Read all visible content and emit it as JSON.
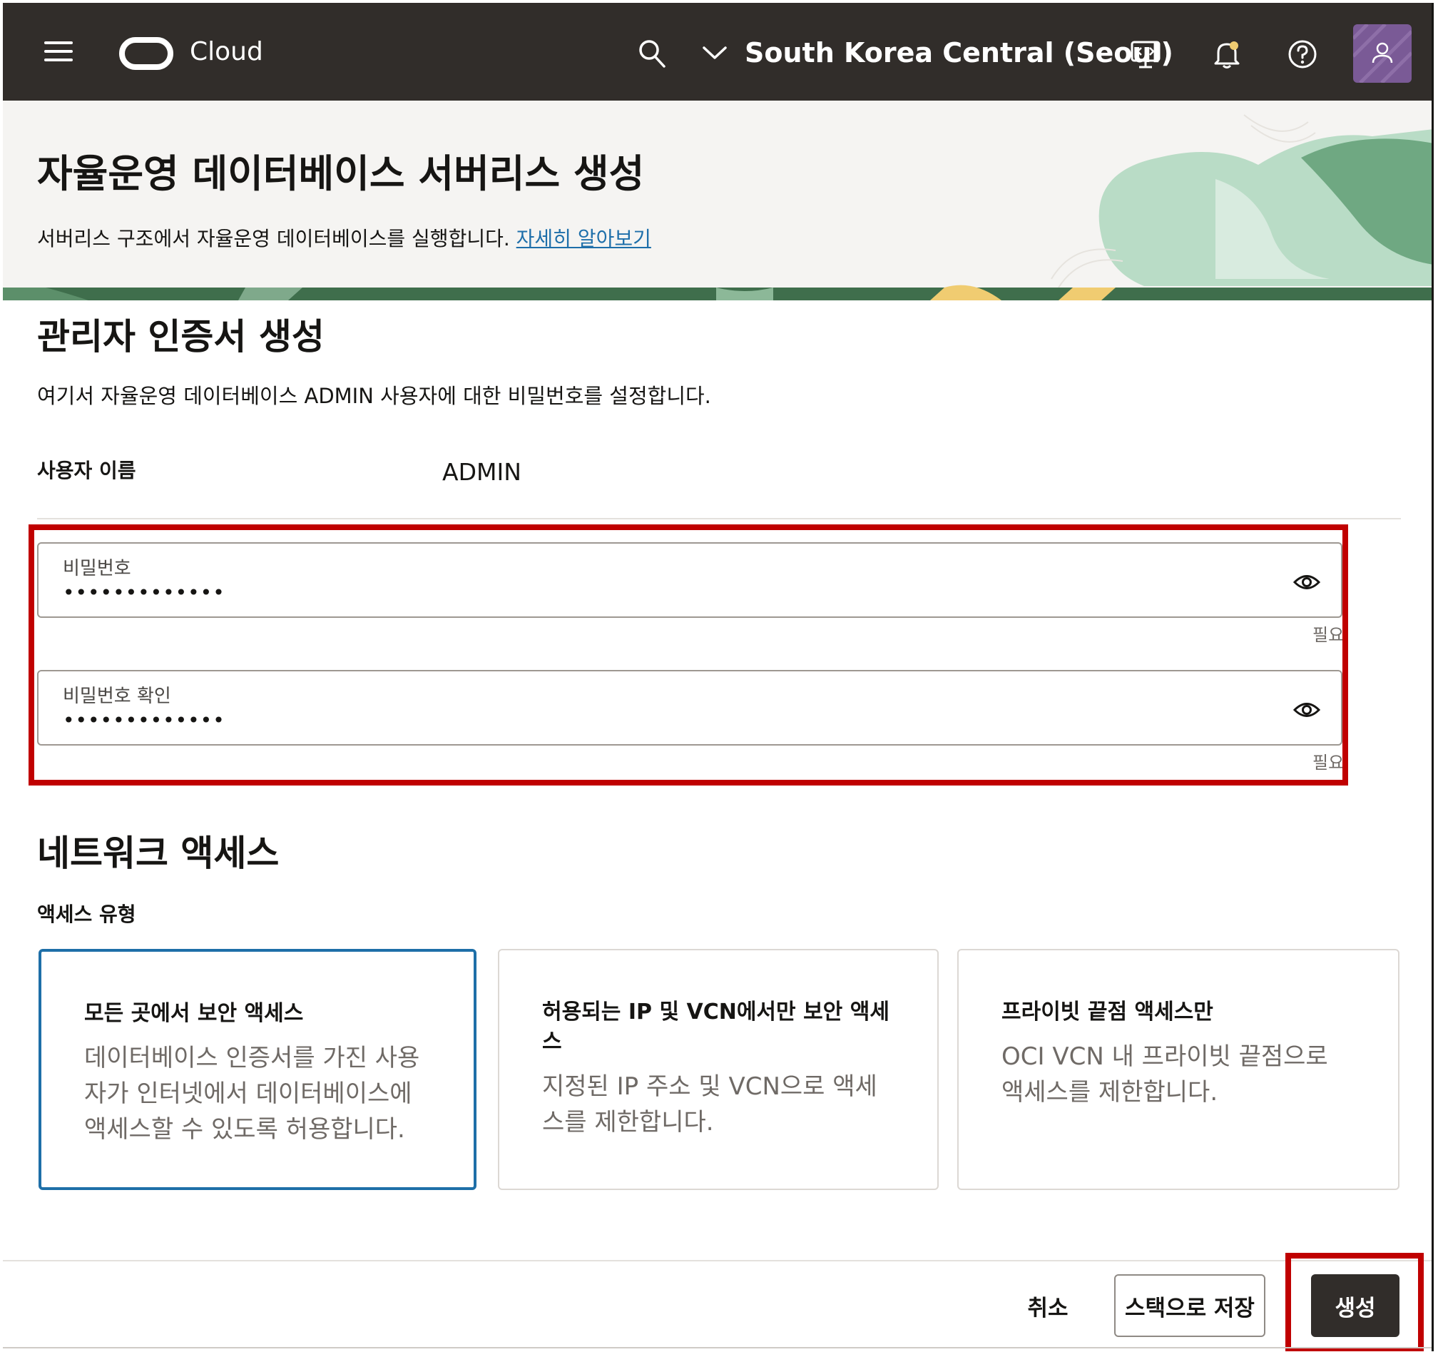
{
  "topbar": {
    "brand": "Cloud",
    "region": "South Korea Central (Seoul)",
    "icons": [
      "menu-icon",
      "oracle-logo",
      "search-icon",
      "chevron-down-icon",
      "code-editor-icon",
      "bell-icon",
      "help-icon",
      "user-icon"
    ],
    "avatar_color": "#7a5a96",
    "bar_color": "#312d2a"
  },
  "header": {
    "title": "자율운영 데이터베이스 서버리스 생성",
    "description": "서버리스 구조에서 자율운영 데이터베이스를 실행합니다.",
    "learn_more": "자세히 알아보기"
  },
  "credentials": {
    "title": "관리자 인증서 생성",
    "description": "여기서 자율운영 데이터베이스 ADMIN 사용자에 대한 비밀번호를 설정합니다.",
    "username_label": "사용자 이름",
    "username_value": "ADMIN",
    "password_label": "비밀번호",
    "password_value": "•••••••••••••",
    "password_required": "필요",
    "confirm_label": "비밀번호 확인",
    "confirm_value": "•••••••••••••",
    "confirm_required": "필요"
  },
  "network": {
    "title": "네트워크 액세스",
    "access_type_label": "액세스 유형",
    "options": [
      {
        "title": "모든 곳에서 보안 액세스",
        "description": "데이터베이스 인증서를 가진 사용자가 인터넷에서 데이터베이스에 액세스할 수 있도록 허용합니다.",
        "desc_lines": [
          "데이터베이스 인증서를 가진 사용",
          "자가 인터넷에서 데이터베이스에",
          "액세스할 수 있도록 허용합니다."
        ],
        "selected": true
      },
      {
        "title": "허용되는 IP 및 VCN에서만 보안 액세스",
        "title_lines": [
          "허용되는 IP 및 VCN에서만 보안 액세",
          "스"
        ],
        "description": "지정된 IP 주소 및 VCN으로 액세스를 제한합니다.",
        "desc_lines": [
          "지정된 IP 주소 및 VCN으로 액세",
          "스를 제한합니다."
        ],
        "selected": false
      },
      {
        "title": "프라이빗 끝점 액세스만",
        "description": "OCI VCN 내 프라이빗 끝점으로 액세스를 제한합니다.",
        "desc_lines": [
          "OCI VCN 내 프라이빗 끝점으로",
          "액세스를 제한합니다."
        ],
        "selected": false
      }
    ]
  },
  "footer": {
    "cancel": "취소",
    "save_stack": "스택으로 저장",
    "create": "생성"
  },
  "colors": {
    "highlight_box": "#c00000",
    "selected_card_border": "#1e6fa8",
    "link": "#1e6faa"
  }
}
